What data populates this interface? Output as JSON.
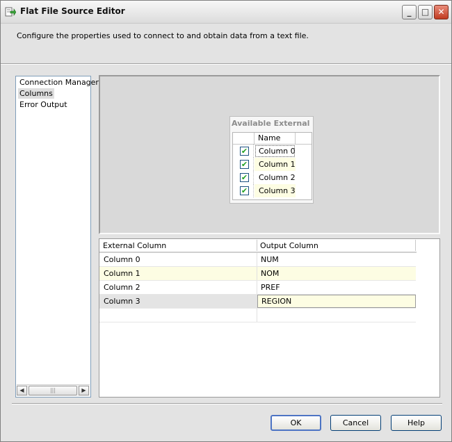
{
  "window": {
    "title": "Flat File Source Editor",
    "controls": {
      "minimize": "_",
      "maximize": "□",
      "close": "✕"
    }
  },
  "description": "Configure the properties used to connect to and obtain data from a text file.",
  "nav": {
    "items": [
      {
        "label": "Connection Manager",
        "selected": false
      },
      {
        "label": "Columns",
        "selected": true
      },
      {
        "label": "Error Output",
        "selected": false
      }
    ],
    "scroll_left": "◀",
    "scroll_right": "▶",
    "scroll_thumb": "|||"
  },
  "available": {
    "title": "Available External ...",
    "header_name": "Name",
    "check_mark": "✔",
    "columns": [
      {
        "name": "Column 0",
        "checked": true
      },
      {
        "name": "Column 1",
        "checked": true
      },
      {
        "name": "Column 2",
        "checked": true
      },
      {
        "name": "Column 3",
        "checked": true
      }
    ]
  },
  "mapping": {
    "headers": {
      "external": "External Column",
      "output": "Output Column"
    },
    "rows": [
      {
        "external": "Column 0",
        "output": "NUM"
      },
      {
        "external": "Column 1",
        "output": "NOM"
      },
      {
        "external": "Column 2",
        "output": "PREF"
      },
      {
        "external": "Column 3",
        "output": "REGION"
      }
    ]
  },
  "buttons": {
    "ok": "OK",
    "cancel": "Cancel",
    "help": "Help"
  }
}
